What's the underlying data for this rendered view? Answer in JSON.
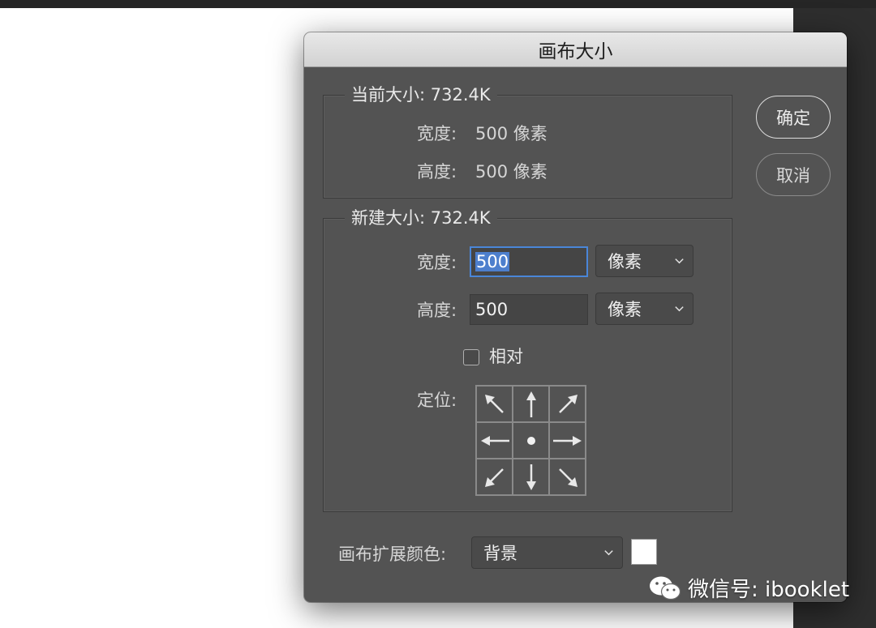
{
  "dialog": {
    "title": "画布大小",
    "current_size": {
      "legend": "当前大小: 732.4K",
      "width_label": "宽度:",
      "width_value": "500 像素",
      "height_label": "高度:",
      "height_value": "500 像素"
    },
    "new_size": {
      "legend": "新建大小: 732.4K",
      "width_label": "宽度:",
      "width_value": "500",
      "width_unit": "像素",
      "height_label": "高度:",
      "height_value": "500",
      "height_unit": "像素",
      "relative_label": "相对",
      "relative_checked": false,
      "anchor_label": "定位:",
      "anchor_selected": "center"
    },
    "ok_label": "确定",
    "cancel_label": "取消",
    "extension_color_label": "画布扩展颜色:",
    "extension_color_value": "背景",
    "extension_swatch_color": "#ffffff"
  },
  "watermark": {
    "text": "微信号: ibooklet",
    "icon": "wechat-icon"
  },
  "colors": {
    "dialog_bg": "#535353",
    "titlebar_bg": "#d8d8d8",
    "focus_accent": "#4a86d8",
    "canvas_bg": "#ffffff"
  }
}
